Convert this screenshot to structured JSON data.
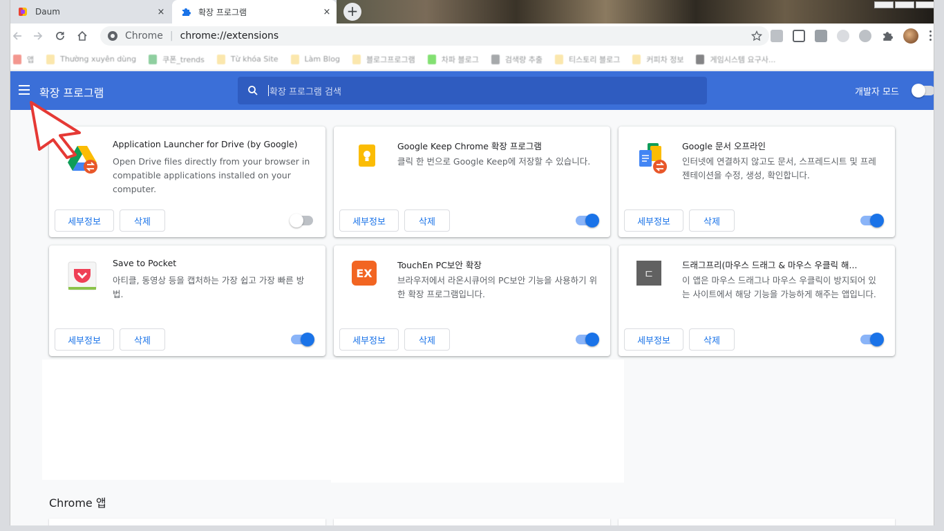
{
  "browser": {
    "tabs": [
      {
        "title": "Daum",
        "active": false,
        "favicon": "daum-icon"
      },
      {
        "title": "확장 프로그램",
        "active": true,
        "favicon": "puzzle-icon"
      }
    ],
    "close_glyph": "×",
    "new_tab_glyph": "+",
    "omnibox": {
      "site": "Chrome",
      "separator": "|",
      "url": "chrome://extensions"
    },
    "bookmarks": [
      {
        "label": "앱",
        "icon": "apps-icon",
        "color": "#ea4335"
      },
      {
        "label": "Thường xuyên dùng",
        "icon": "folder-icon",
        "color": "#f9d46b"
      },
      {
        "label": "쿠폰_trends",
        "icon": "green-icon",
        "color": "#34a853"
      },
      {
        "label": "Từ khóa Site",
        "icon": "folder-icon",
        "color": "#f9d46b"
      },
      {
        "label": "Làm Blog",
        "icon": "folder-icon",
        "color": "#f9d46b"
      },
      {
        "label": "블로그프로그램",
        "icon": "folder-icon",
        "color": "#f9d46b"
      },
      {
        "label": "차파 블로그",
        "icon": "chat-icon",
        "color": "#1ec800"
      },
      {
        "label": "검색량 추출",
        "icon": "globe-icon",
        "color": "#5f6368"
      },
      {
        "label": "티스토리 블로그",
        "icon": "folder-icon",
        "color": "#f9d46b"
      },
      {
        "label": "커피차 정보",
        "icon": "folder-icon",
        "color": "#f9d46b"
      },
      {
        "label": "게임시스템 요구사...",
        "icon": "dark-icon",
        "color": "#202124"
      }
    ]
  },
  "extensions_page": {
    "title": "확장 프로그램",
    "search_placeholder": "확장 프로그램 검색",
    "dev_mode_label": "개발자 모드",
    "dev_mode_on": false,
    "details_label": "세부정보",
    "remove_label": "삭제",
    "cards": [
      {
        "name": "Application Launcher for Drive (by Google)",
        "description": "Open Drive files directly from your browser in compatible applications installed on your computer.",
        "enabled": false,
        "icon": "google-drive-icon"
      },
      {
        "name": "Google Keep Chrome 확장 프로그램",
        "description": "클릭 한 번으로 Google Keep에 저장할 수 있습니다.",
        "enabled": true,
        "icon": "google-keep-icon"
      },
      {
        "name": "Google 문서 오프라인",
        "description": "인터넷에 연결하지 않고도 문서, 스프레드시트 및 프레젠테이션을 수정, 생성, 확인합니다.",
        "enabled": true,
        "icon": "google-docs-icon"
      },
      {
        "name": "Save to Pocket",
        "description": "아티클, 동영상 등을 캡처하는 가장 쉽고 가장 빠른 방법.",
        "enabled": true,
        "icon": "pocket-icon"
      },
      {
        "name": "TouchEn PC보안 확장",
        "description": "브라우저에서 라온시큐어의 PC보안 기능을 사용하기 위한 확장 프로그램입니다.",
        "enabled": true,
        "icon": "touchen-ex-icon"
      },
      {
        "name": "드래그프리(마우스 드래그 & 마우스 우클릭 해...",
        "description": "이 앱은 마우스 드래그나 마우스 우클릭이 방지되어 있는 사이트에서 해당 기능을 가능하게 해주는 앱입니다.",
        "enabled": true,
        "icon": "dragfree-icon"
      }
    ],
    "touchen_icon_text": "EX",
    "dragfree_icon_text": "ㄷ",
    "chrome_apps_title": "Chrome 앱"
  },
  "colors": {
    "header": "#3b6fd8",
    "accent": "#1a73e8"
  }
}
